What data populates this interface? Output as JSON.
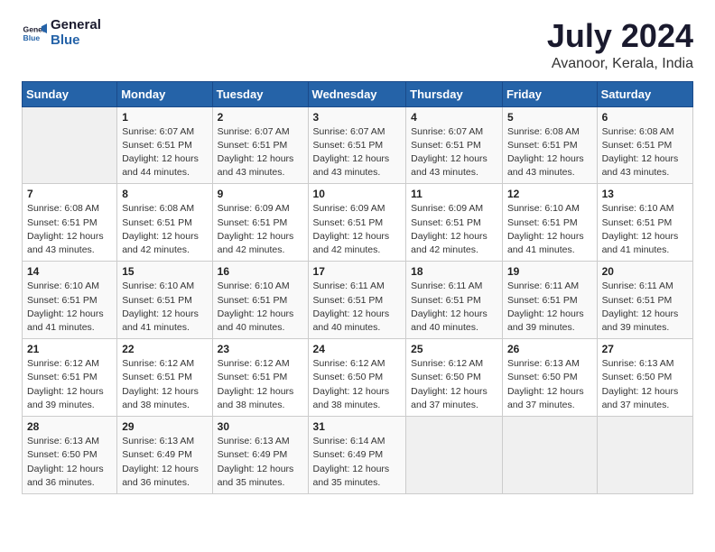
{
  "logo": {
    "line1": "General",
    "line2": "Blue"
  },
  "title": "July 2024",
  "location": "Avanoor, Kerala, India",
  "days_header": [
    "Sunday",
    "Monday",
    "Tuesday",
    "Wednesday",
    "Thursday",
    "Friday",
    "Saturday"
  ],
  "weeks": [
    [
      {
        "day": "",
        "info": ""
      },
      {
        "day": "1",
        "info": "Sunrise: 6:07 AM\nSunset: 6:51 PM\nDaylight: 12 hours\nand 44 minutes."
      },
      {
        "day": "2",
        "info": "Sunrise: 6:07 AM\nSunset: 6:51 PM\nDaylight: 12 hours\nand 43 minutes."
      },
      {
        "day": "3",
        "info": "Sunrise: 6:07 AM\nSunset: 6:51 PM\nDaylight: 12 hours\nand 43 minutes."
      },
      {
        "day": "4",
        "info": "Sunrise: 6:07 AM\nSunset: 6:51 PM\nDaylight: 12 hours\nand 43 minutes."
      },
      {
        "day": "5",
        "info": "Sunrise: 6:08 AM\nSunset: 6:51 PM\nDaylight: 12 hours\nand 43 minutes."
      },
      {
        "day": "6",
        "info": "Sunrise: 6:08 AM\nSunset: 6:51 PM\nDaylight: 12 hours\nand 43 minutes."
      }
    ],
    [
      {
        "day": "7",
        "info": "Sunrise: 6:08 AM\nSunset: 6:51 PM\nDaylight: 12 hours\nand 43 minutes."
      },
      {
        "day": "8",
        "info": "Sunrise: 6:08 AM\nSunset: 6:51 PM\nDaylight: 12 hours\nand 42 minutes."
      },
      {
        "day": "9",
        "info": "Sunrise: 6:09 AM\nSunset: 6:51 PM\nDaylight: 12 hours\nand 42 minutes."
      },
      {
        "day": "10",
        "info": "Sunrise: 6:09 AM\nSunset: 6:51 PM\nDaylight: 12 hours\nand 42 minutes."
      },
      {
        "day": "11",
        "info": "Sunrise: 6:09 AM\nSunset: 6:51 PM\nDaylight: 12 hours\nand 42 minutes."
      },
      {
        "day": "12",
        "info": "Sunrise: 6:10 AM\nSunset: 6:51 PM\nDaylight: 12 hours\nand 41 minutes."
      },
      {
        "day": "13",
        "info": "Sunrise: 6:10 AM\nSunset: 6:51 PM\nDaylight: 12 hours\nand 41 minutes."
      }
    ],
    [
      {
        "day": "14",
        "info": "Sunrise: 6:10 AM\nSunset: 6:51 PM\nDaylight: 12 hours\nand 41 minutes."
      },
      {
        "day": "15",
        "info": "Sunrise: 6:10 AM\nSunset: 6:51 PM\nDaylight: 12 hours\nand 41 minutes."
      },
      {
        "day": "16",
        "info": "Sunrise: 6:10 AM\nSunset: 6:51 PM\nDaylight: 12 hours\nand 40 minutes."
      },
      {
        "day": "17",
        "info": "Sunrise: 6:11 AM\nSunset: 6:51 PM\nDaylight: 12 hours\nand 40 minutes."
      },
      {
        "day": "18",
        "info": "Sunrise: 6:11 AM\nSunset: 6:51 PM\nDaylight: 12 hours\nand 40 minutes."
      },
      {
        "day": "19",
        "info": "Sunrise: 6:11 AM\nSunset: 6:51 PM\nDaylight: 12 hours\nand 39 minutes."
      },
      {
        "day": "20",
        "info": "Sunrise: 6:11 AM\nSunset: 6:51 PM\nDaylight: 12 hours\nand 39 minutes."
      }
    ],
    [
      {
        "day": "21",
        "info": "Sunrise: 6:12 AM\nSunset: 6:51 PM\nDaylight: 12 hours\nand 39 minutes."
      },
      {
        "day": "22",
        "info": "Sunrise: 6:12 AM\nSunset: 6:51 PM\nDaylight: 12 hours\nand 38 minutes."
      },
      {
        "day": "23",
        "info": "Sunrise: 6:12 AM\nSunset: 6:51 PM\nDaylight: 12 hours\nand 38 minutes."
      },
      {
        "day": "24",
        "info": "Sunrise: 6:12 AM\nSunset: 6:50 PM\nDaylight: 12 hours\nand 38 minutes."
      },
      {
        "day": "25",
        "info": "Sunrise: 6:12 AM\nSunset: 6:50 PM\nDaylight: 12 hours\nand 37 minutes."
      },
      {
        "day": "26",
        "info": "Sunrise: 6:13 AM\nSunset: 6:50 PM\nDaylight: 12 hours\nand 37 minutes."
      },
      {
        "day": "27",
        "info": "Sunrise: 6:13 AM\nSunset: 6:50 PM\nDaylight: 12 hours\nand 37 minutes."
      }
    ],
    [
      {
        "day": "28",
        "info": "Sunrise: 6:13 AM\nSunset: 6:50 PM\nDaylight: 12 hours\nand 36 minutes."
      },
      {
        "day": "29",
        "info": "Sunrise: 6:13 AM\nSunset: 6:49 PM\nDaylight: 12 hours\nand 36 minutes."
      },
      {
        "day": "30",
        "info": "Sunrise: 6:13 AM\nSunset: 6:49 PM\nDaylight: 12 hours\nand 35 minutes."
      },
      {
        "day": "31",
        "info": "Sunrise: 6:14 AM\nSunset: 6:49 PM\nDaylight: 12 hours\nand 35 minutes."
      },
      {
        "day": "",
        "info": ""
      },
      {
        "day": "",
        "info": ""
      },
      {
        "day": "",
        "info": ""
      }
    ]
  ]
}
